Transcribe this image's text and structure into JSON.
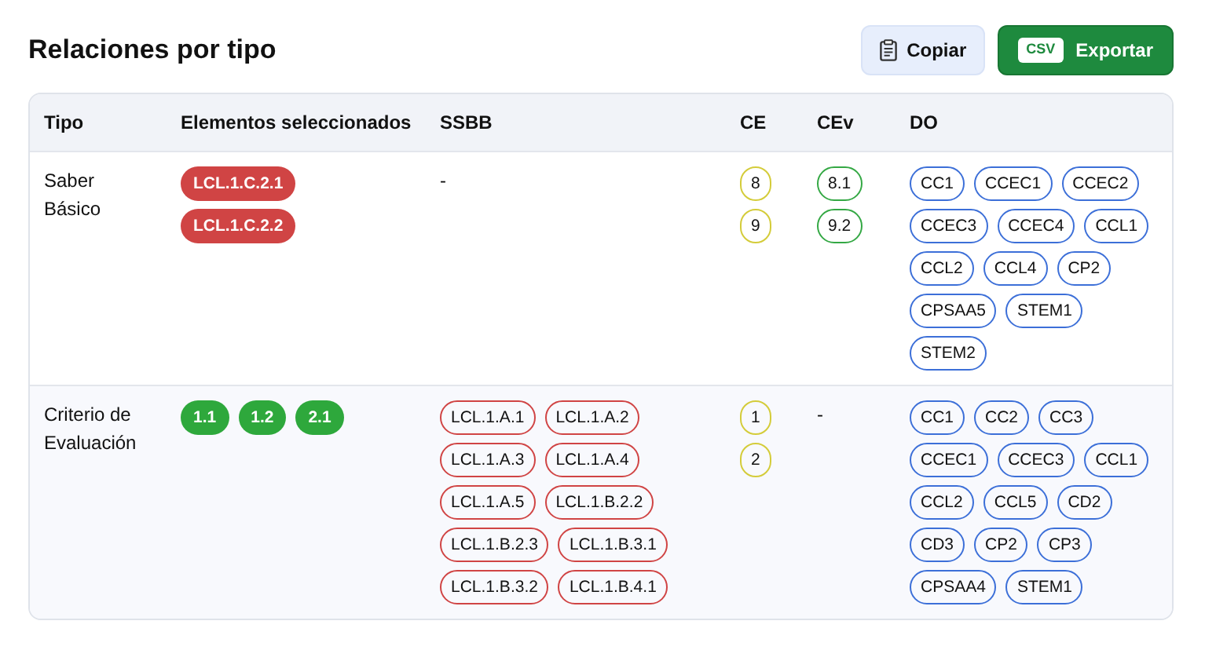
{
  "title": "Relaciones por tipo",
  "buttons": [
    {
      "kind": "copy",
      "label": "Copiar"
    },
    {
      "kind": "export",
      "badge": "CSV",
      "label": "Exportar"
    }
  ],
  "table": {
    "columns": [
      "Tipo",
      "Elementos seleccionados",
      "SSBB",
      "CE",
      "CEv",
      "DO"
    ],
    "rows": [
      {
        "cells": [
          {
            "kind": "text",
            "text": "Saber Básico"
          },
          {
            "kind": "filled",
            "color": "#d04444",
            "items": [
              "LCL.1.C.2.1",
              "LCL.1.C.2.2"
            ]
          },
          {
            "kind": "text",
            "text": "-"
          },
          {
            "kind": "outline",
            "color": "#d4cc3a",
            "items": [
              "8",
              "9"
            ]
          },
          {
            "kind": "outline",
            "color": "#34a844",
            "items": [
              "8.1",
              "9.2"
            ]
          },
          {
            "kind": "outline",
            "color": "#3c6fd8",
            "items": [
              "CC1",
              "CCEC1",
              "CCEC2",
              "CCEC3",
              "CCEC4",
              "CCL1",
              "CCL2",
              "CCL4",
              "CP2",
              "CPSAA5",
              "STEM1",
              "STEM2"
            ]
          }
        ]
      },
      {
        "cells": [
          {
            "kind": "text",
            "text": "Criterio de Evaluación"
          },
          {
            "kind": "filled",
            "color": "#2ea83c",
            "items": [
              "1.1",
              "1.2",
              "2.1"
            ]
          },
          {
            "kind": "outline",
            "color": "#d04444",
            "items": [
              "LCL.1.A.1",
              "LCL.1.A.2",
              "LCL.1.A.3",
              "LCL.1.A.4",
              "LCL.1.A.5",
              "LCL.1.B.2.2",
              "LCL.1.B.2.3",
              "LCL.1.B.3.1",
              "LCL.1.B.3.2",
              "LCL.1.B.4.1"
            ]
          },
          {
            "kind": "outline",
            "color": "#d4cc3a",
            "items": [
              "1",
              "2"
            ]
          },
          {
            "kind": "text",
            "text": "-"
          },
          {
            "kind": "outline",
            "color": "#3c6fd8",
            "items": [
              "CC1",
              "CC2",
              "CC3",
              "CCEC1",
              "CCEC3",
              "CCL1",
              "CCL2",
              "CCL5",
              "CD2",
              "CD3",
              "CP2",
              "CP3",
              "CPSAA4",
              "STEM1"
            ]
          }
        ]
      }
    ]
  }
}
